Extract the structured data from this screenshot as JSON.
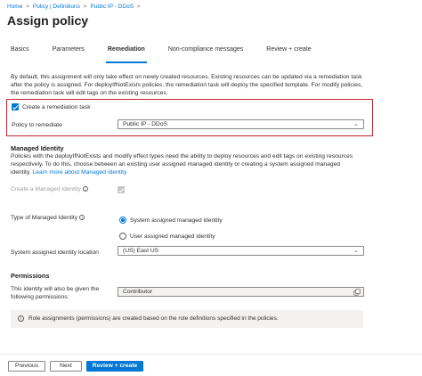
{
  "breadcrumb": {
    "items": [
      "Home",
      "Policy | Definitions",
      "Public IP - DDoS"
    ],
    "separator": ">"
  },
  "page": {
    "title": "Assign policy",
    "more_label": "..."
  },
  "tabs": [
    {
      "label": "Basics",
      "active": false
    },
    {
      "label": "Parameters",
      "active": false
    },
    {
      "label": "Remediation",
      "active": true
    },
    {
      "label": "Non-compliance messages",
      "active": false
    },
    {
      "label": "Review + create",
      "active": false
    }
  ],
  "intro": {
    "text": "By default, this assignment will only take effect on newly created resources. Existing resources can be updated via a remediation task after the policy is assigned. For deployIfNotExists policies, the remediation task will deploy the specified template. For modify policies, the remediation task will edit tags on the existing resources."
  },
  "remediation": {
    "create_task_label": "Create a remediation task",
    "create_task_checked": true,
    "policy_label": "Policy to remediate",
    "policy_value": "Public IP - DDoS"
  },
  "managed_identity": {
    "title": "Managed Identity",
    "description": "Policies with the deployIfNotExists and modify effect types need the ability to deploy resources and edit tags on existing resources respectively. To do this, choose between an existing user assigned managed identity or creating a system assigned managed identity.",
    "learn_more": "Learn more about Managed Identity",
    "create_label": "Create a Managed Identity",
    "create_checked": true,
    "type_label": "Type of Managed Identity",
    "options": [
      "System assigned managed identity",
      "User assigned managed identity"
    ],
    "selected_option": 0,
    "location_label": "System assigned identity location",
    "location_value": "(US) East US"
  },
  "permissions": {
    "title": "Permissions",
    "label": "This identity will also be given the following permissions:",
    "value": "Contributor",
    "info": "Role assignments (permissions) are created based on the role definitions specified in the policies."
  },
  "footer": {
    "previous": "Previous",
    "next": "Next",
    "review": "Review + create"
  },
  "colors": {
    "accent": "#0078d4",
    "highlight_border": "#c4262e"
  }
}
